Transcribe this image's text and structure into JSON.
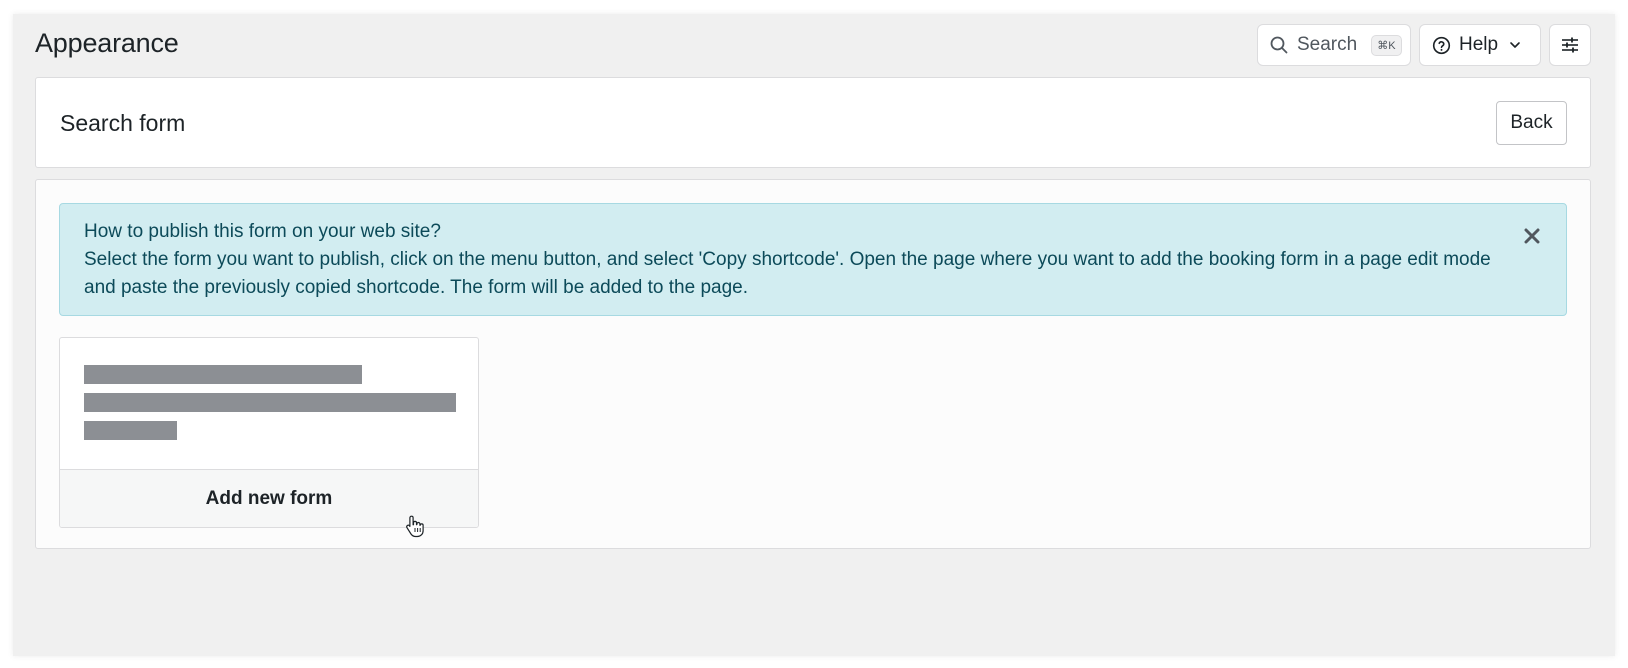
{
  "header": {
    "title": "Appearance",
    "search_label": "Search",
    "search_shortcut": "⌘K",
    "help_label": "Help",
    "icons": {
      "search": "search-icon",
      "help": "help-circle-icon",
      "chevron": "chevron-down-icon",
      "settings": "sliders-icon"
    }
  },
  "subheader": {
    "title": "Search form",
    "back_label": "Back"
  },
  "notice": {
    "title": "How to publish this form on your web site?",
    "body": "Select the form you want to publish, click on the menu button, and select 'Copy shortcode'. Open the page where you want to add the booking form in a page edit mode and paste the previously copied shortcode. The form will be added to the page.",
    "close_icon": "close-icon",
    "colors": {
      "background": "#d2edf1",
      "border": "#a7d9e2",
      "text": "#0c4a59"
    }
  },
  "form_card": {
    "add_label": "Add new form"
  }
}
